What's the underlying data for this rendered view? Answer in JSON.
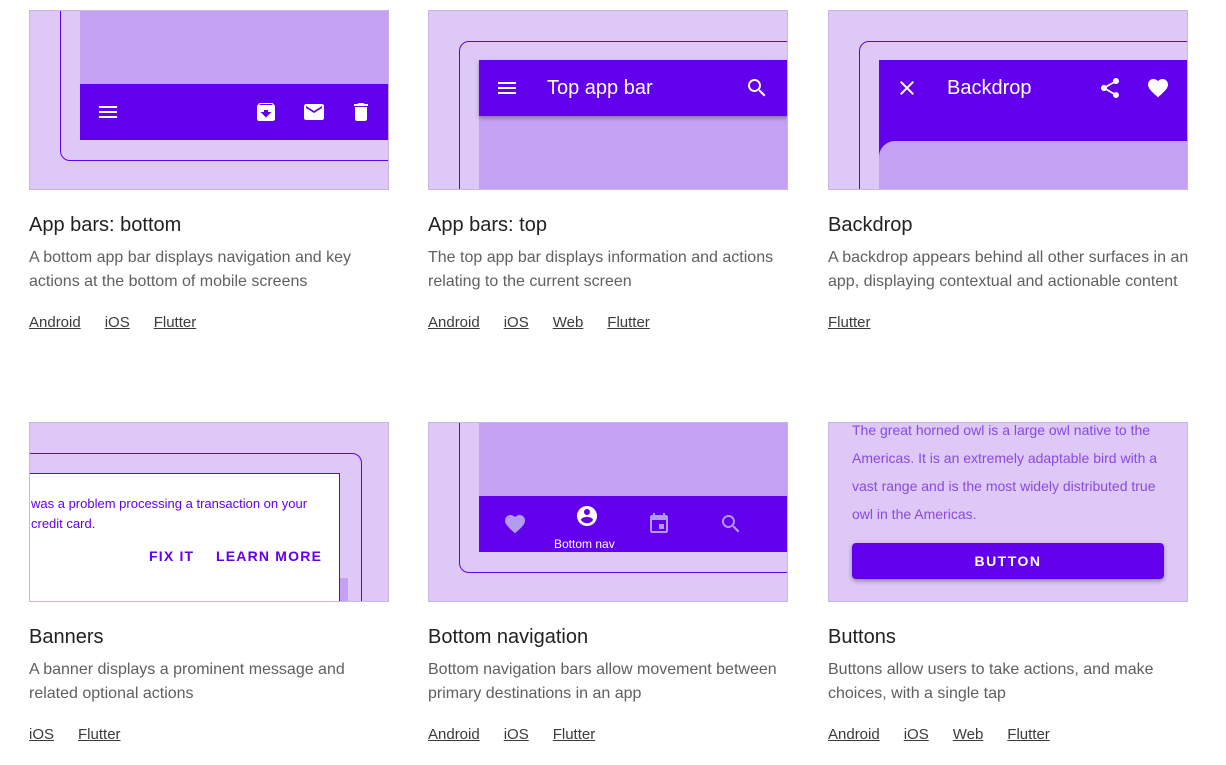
{
  "colors": {
    "primary": "#6200ee",
    "surface": "#c4a1f3",
    "background": "#ddc8f6"
  },
  "cards": [
    {
      "title": "App bars: bottom",
      "description": "A bottom app bar displays navigation and key actions at the bottom of mobile screens",
      "links": [
        "Android",
        "iOS",
        "Flutter"
      ],
      "icons": [
        "menu-icon",
        "archive-icon",
        "mail-icon",
        "delete-icon"
      ]
    },
    {
      "title": "App bars: top",
      "description": "The top app bar displays information and actions relating to the current screen",
      "links": [
        "Android",
        "iOS",
        "Web",
        "Flutter"
      ],
      "preview": {
        "bar_title": "Top app bar"
      },
      "icons": [
        "menu-icon",
        "search-icon"
      ]
    },
    {
      "title": "Backdrop",
      "description": "A backdrop appears behind all other surfaces in an app, displaying contextual and actionable content",
      "links": [
        "Flutter"
      ],
      "preview": {
        "bar_title": "Backdrop"
      },
      "icons": [
        "close-icon",
        "share-icon",
        "heart-icon"
      ]
    },
    {
      "title": "Banners",
      "description": "A banner displays a prominent message and related optional actions",
      "links": [
        "iOS",
        "Flutter"
      ],
      "preview": {
        "message": "was a problem processing a transaction on your credit card.",
        "action_1": "FIX IT",
        "action_2": "LEARN MORE"
      }
    },
    {
      "title": "Bottom navigation",
      "description": "Bottom navigation bars allow movement between primary destinations in an app",
      "links": [
        "Android",
        "iOS",
        "Flutter"
      ],
      "preview": {
        "active_label": "Bottom nav"
      },
      "icons": [
        "heart-icon",
        "account-circle-icon",
        "calendar-icon",
        "search-icon"
      ]
    },
    {
      "title": "Buttons",
      "description": "Buttons allow users to take actions, and make choices, with a single tap",
      "links": [
        "Android",
        "iOS",
        "Web",
        "Flutter"
      ],
      "preview": {
        "text": "The great horned owl is a large owl native to the Americas. It is an extremely adaptable bird with a vast range and is the most widely distributed true owl in the Americas.",
        "button_label": "BUTTON"
      }
    }
  ]
}
